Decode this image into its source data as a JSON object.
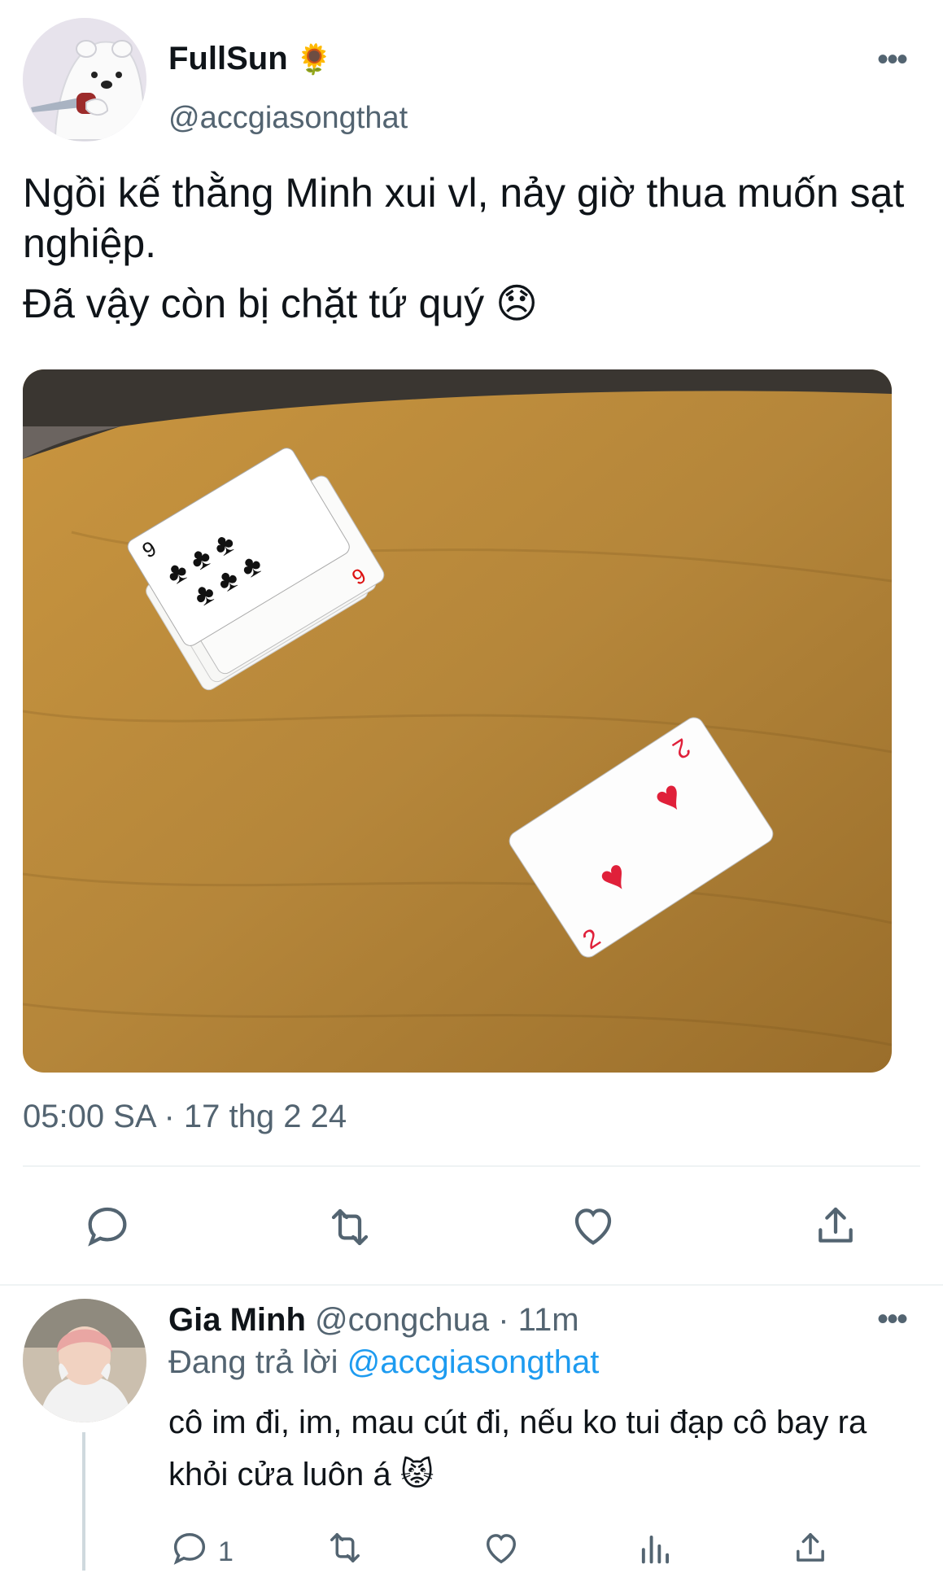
{
  "tweet": {
    "display_name": "FullSun",
    "verified_emoji": "🌻",
    "handle": "@accgiasongthat",
    "more": "•••",
    "text_line1": "Ngồi kế thằng Minh xui vl, nảy giờ thua muốn sạt nghiệp.",
    "text_line2": "Đã vậy còn bị chặt tứ quý 😞",
    "timestamp": "05:00 SA · 17 thg 2 24",
    "actions": [
      "reply-icon",
      "retweet-icon",
      "like-icon",
      "share-icon"
    ]
  },
  "photo": {
    "table_color": "#b98a3a",
    "cards_stack": [
      "9",
      "9",
      "9",
      "9"
    ],
    "single_card": "2"
  },
  "reply": {
    "display_name": "Gia Minh",
    "handle": "@congchua",
    "time": "· 11m",
    "more": "•••",
    "replying_prefix": "Đang trả lời",
    "replying_handle": "@accgiasongthat",
    "text": "cô im đi, im, mau cút đi, nếu ko tui đạp cô bay ra khỏi cửa luôn á 😾",
    "reply_count": "1",
    "actions": [
      "reply-icon",
      "retweet-icon",
      "like-icon",
      "views-icon",
      "share-icon"
    ]
  },
  "colors": {
    "accent": "#1d9bf0",
    "secondary_text": "#536471",
    "divider": "#eff3f4"
  }
}
